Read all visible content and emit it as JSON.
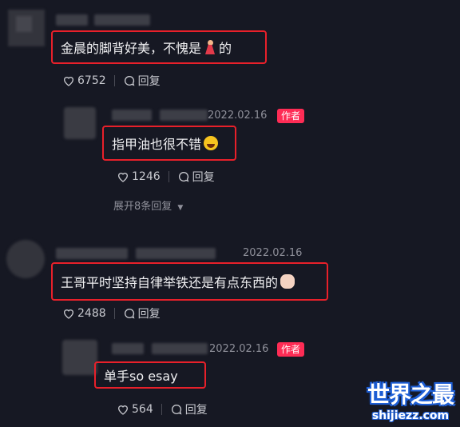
{
  "comments": [
    {
      "text": "金晨的脚背好美，不愧是",
      "text_suffix": "的",
      "likes": "6752",
      "reply_label": "回复"
    },
    {
      "date": "2022.02.16",
      "badge": "作者",
      "text": "指甲油也很不错",
      "likes": "1246",
      "reply_label": "回复",
      "expand_label": "展开8条回复"
    },
    {
      "date": "2022.02.16",
      "text": "王哥平时坚持自律举铁还是有点东西的",
      "likes": "2488",
      "reply_label": "回复"
    },
    {
      "date": "2022.02.16",
      "badge": "作者",
      "text": "单手so esay",
      "likes": "564",
      "reply_label": "回复"
    }
  ],
  "watermark": {
    "title": "世界之最",
    "url": "shijiezz.com"
  },
  "colors": {
    "background": "#161823",
    "highlight_box": "#e8202a",
    "author_badge": "#fe2c55"
  }
}
